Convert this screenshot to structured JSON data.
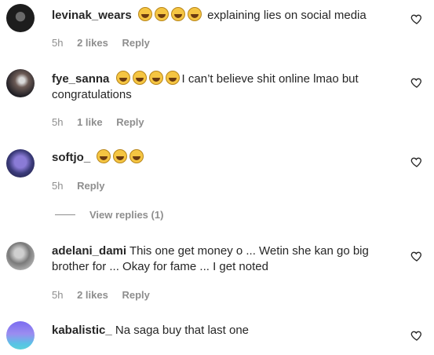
{
  "comments": [
    {
      "username": "levinak_wears",
      "emoji_count": 4,
      "text": "explaining lies on social media",
      "time": "5h",
      "likes": "2 likes",
      "reply": "Reply"
    },
    {
      "username": "fye_sanna",
      "emoji_count": 4,
      "text": "I can’t believe shit online lmao but congratulations",
      "time": "5h",
      "likes": "1 like",
      "reply": "Reply"
    },
    {
      "username": "softjo_",
      "emoji_count": 3,
      "text": "",
      "time": "5h",
      "likes": "",
      "reply": "Reply"
    },
    {
      "username": "adelani_dami",
      "emoji_count": 0,
      "text": "This one get money o ... Wetin she kan go big brother for ... Okay for fame ... I get noted",
      "time": "5h",
      "likes": "2 likes",
      "reply": "Reply"
    },
    {
      "username": "kabalistic_",
      "emoji_count": 0,
      "text": "Na saga buy that last one",
      "time": "",
      "likes": "",
      "reply": ""
    }
  ],
  "view_replies": "View replies (1)",
  "icons": {
    "like": "heart-outline-icon"
  },
  "colors": {
    "text": "#262626",
    "meta": "#8e8e8e",
    "emoji": "#f5c542"
  }
}
